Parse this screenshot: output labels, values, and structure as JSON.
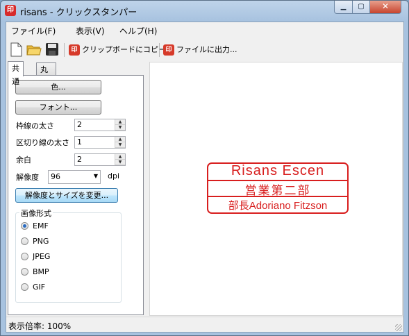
{
  "window": {
    "title": "risans - クリックスタンパー",
    "controls": {
      "minimize": "▁",
      "maximize": "▢",
      "close": "✕"
    }
  },
  "menu": [
    "ファイル(F)",
    "表示(V)",
    "ヘルプ(H)"
  ],
  "toolbar": {
    "icons": [
      "new-document-icon",
      "open-folder-icon",
      "save-icon"
    ],
    "copy_label": "クリップボードにコピー",
    "export_label": "ファイルに出力...",
    "stamp_glyph": "印"
  },
  "tabs": [
    "共通",
    "丸印･角印"
  ],
  "panel": {
    "color_button": "色...",
    "font_button": "フォント...",
    "border_width_label": "枠線の太さ",
    "border_width_value": "2",
    "divider_width_label": "区切り線の太さ",
    "divider_width_value": "1",
    "margin_label": "余白",
    "margin_value": "2",
    "resolution_label": "解像度",
    "resolution_value": "96",
    "resolution_unit": "dpi",
    "resize_button": "解像度とサイズを変更...",
    "format_group": "画像形式",
    "formats": [
      "EMF",
      "PNG",
      "JPEG",
      "BMP",
      "GIF"
    ],
    "selected_format": "EMF"
  },
  "stamp": {
    "line1": "Risans Escen",
    "line2": "営業第二部",
    "line3": "部長Adoriano Fitzson",
    "color": "#d81e1e"
  },
  "status": {
    "zoom": "表示倍率: 100%"
  }
}
